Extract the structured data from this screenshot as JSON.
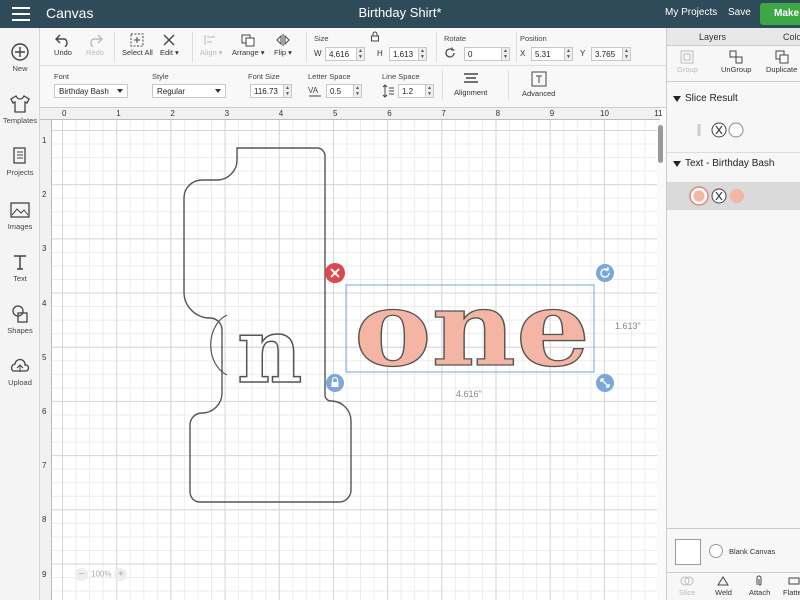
{
  "topbar": {
    "app": "Canvas",
    "doc_title": "Birthday Shirt*",
    "my_projects": "My Projects",
    "save": "Save",
    "make": "Make"
  },
  "sidebar": [
    {
      "label": "New",
      "icon": "plus-circle-icon"
    },
    {
      "label": "Templates",
      "icon": "shirt-icon"
    },
    {
      "label": "Projects",
      "icon": "projects-icon"
    },
    {
      "label": "Images",
      "icon": "image-icon"
    },
    {
      "label": "Text",
      "icon": "text-icon"
    },
    {
      "label": "Shapes",
      "icon": "shapes-icon"
    },
    {
      "label": "Upload",
      "icon": "upload-icon"
    }
  ],
  "toolbar": {
    "undo": "Undo",
    "redo": "Redo",
    "select_all": "Select All",
    "edit": "Edit",
    "align": "Align",
    "arrange": "Arrange",
    "flip": "Flip",
    "size_label": "Size",
    "w_label": "W",
    "w_value": "4.616",
    "h_label": "H",
    "h_value": "1.613",
    "rotate_label": "Rotate",
    "rotate_value": "0",
    "position_label": "Position",
    "x_label": "X",
    "x_value": "5.31",
    "y_label": "Y",
    "y_value": "3.765"
  },
  "textbar": {
    "font_label": "Font",
    "font_value": "Birthday Bash",
    "style_label": "Style",
    "style_value": "Regular",
    "font_size_label": "Font Size",
    "font_size_value": "116.73",
    "letter_space_label": "Letter Space",
    "letter_space_value": "0.5",
    "line_space_label": "Line Space",
    "line_space_value": "1.2",
    "alignment": "Alignment",
    "advanced": "Advanced"
  },
  "rulers": {
    "h": [
      "0",
      "1",
      "2",
      "3",
      "4",
      "5",
      "6",
      "7",
      "8",
      "9",
      "10",
      "11"
    ],
    "v": [
      "1",
      "2",
      "3",
      "4",
      "5",
      "6",
      "7",
      "8",
      "9"
    ]
  },
  "canvas": {
    "big_number": "1",
    "overlay_letter": "n",
    "selected_text": "one",
    "width_readout": "4.616\"",
    "height_readout": "1.613\"",
    "text_color": "#f4b5a5",
    "zoom": "100%"
  },
  "right_panel": {
    "tab_layers": "Layers",
    "tab_color": "Color",
    "group": "Group",
    "ungroup": "UnGroup",
    "duplicate": "Duplicate",
    "slice_result": "Slice Result",
    "text_layer": "Text - Birthday Bash",
    "blank_canvas": "Blank Canvas",
    "slice": "Slice",
    "weld": "Weld",
    "attach": "Attach",
    "flatten": "Flatten"
  }
}
